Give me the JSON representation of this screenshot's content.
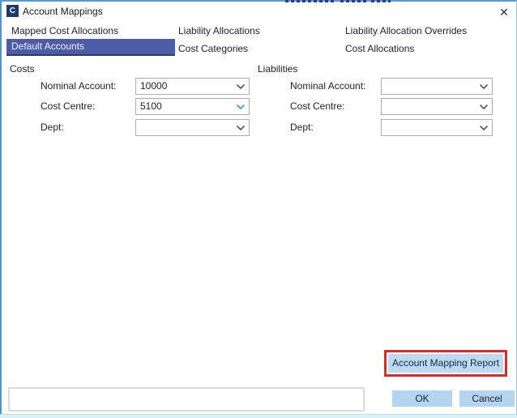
{
  "window": {
    "title": "Account Mappings",
    "icon_letter": "C",
    "close_glyph": "✕"
  },
  "tabs": {
    "row1": [
      "Mapped Cost Allocations",
      "Liability Allocations",
      "Liability Allocation Overrides"
    ],
    "row2": [
      "Default Accounts",
      "Cost Categories",
      "Cost Allocations"
    ],
    "selected": "Default Accounts"
  },
  "groups": [
    {
      "label": "Costs",
      "fields": [
        {
          "label": "Nominal Account:",
          "value": "10000"
        },
        {
          "label": "Cost Centre:",
          "value": "5100"
        },
        {
          "label": "Dept:",
          "value": ""
        }
      ]
    },
    {
      "label": "Liabilities",
      "fields": [
        {
          "label": "Nominal Account:",
          "value": ""
        },
        {
          "label": "Cost Centre:",
          "value": ""
        },
        {
          "label": "Dept:",
          "value": ""
        }
      ]
    }
  ],
  "report_button": {
    "label": "Account Mapping Report",
    "highlight_color": "#de2b24"
  },
  "footer": {
    "textbox_value": "",
    "ok_label": "OK",
    "cancel_label": "Cancel"
  },
  "colors": {
    "selected_tab_bg": "#4c5ca6",
    "selected_tab_border": "#2d3a78",
    "button_blue": "#b3d5f0",
    "report_button_bg": "#bed9f2",
    "dialog_border_blue": "#4f94d1",
    "focus_chevron_blue": "#2e95e5"
  }
}
